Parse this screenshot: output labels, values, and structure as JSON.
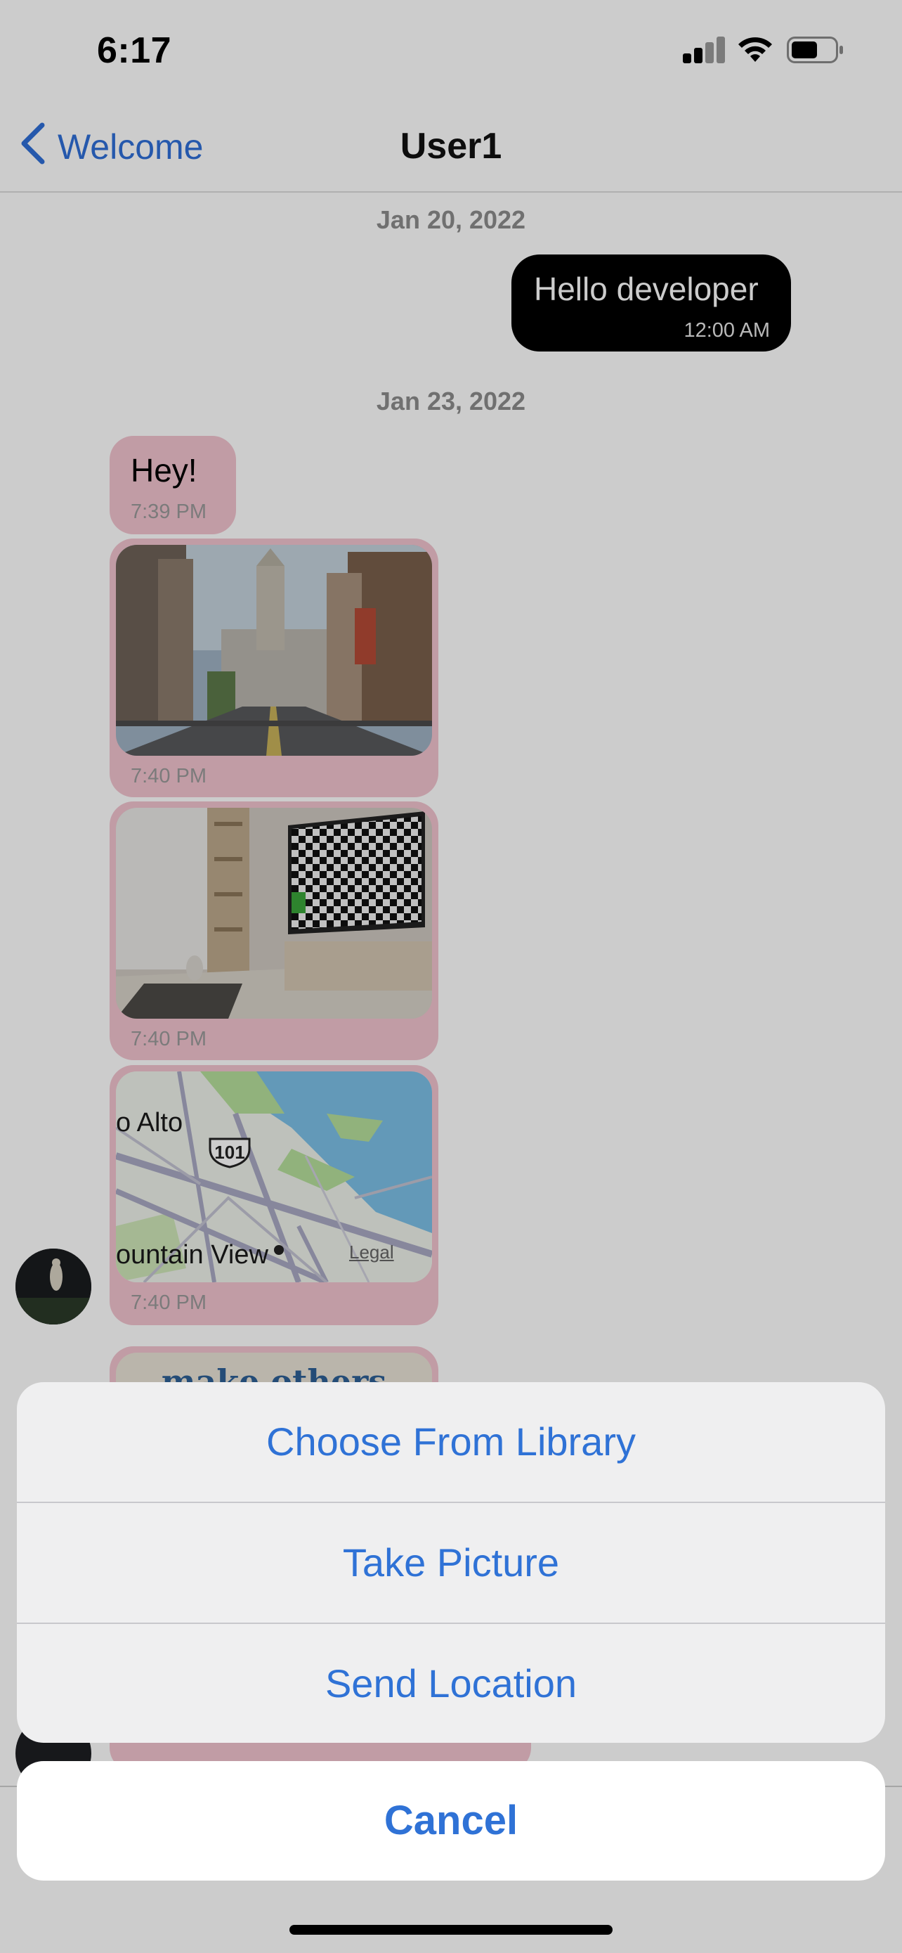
{
  "status_bar": {
    "time": "6:17",
    "signal_icon": "cellular-signal-icon",
    "wifi_icon": "wifi-icon",
    "battery_icon": "battery-icon"
  },
  "nav": {
    "back_label": "Welcome",
    "back_icon": "chevron-left-icon",
    "title": "User1"
  },
  "chat": {
    "dates": [
      "Jan 20, 2022",
      "Jan 23, 2022"
    ],
    "outgoing": [
      {
        "text": "Hello developer",
        "time": "12:00 AM"
      }
    ],
    "incoming": [
      {
        "kind": "text",
        "text": "Hey!",
        "time": "7:39 PM"
      },
      {
        "kind": "image",
        "description_icon": "city-street-photo",
        "time": "7:40 PM"
      },
      {
        "kind": "image",
        "description_icon": "living-room-photo",
        "time": "7:40 PM"
      },
      {
        "kind": "map",
        "time": "7:40 PM",
        "map_labels": {
          "city1": "o Alto",
          "highway": "101",
          "city2": "ountain View",
          "legal": "Legal"
        }
      },
      {
        "kind": "image",
        "partial_text": "make others"
      }
    ]
  },
  "action_sheet": {
    "options": [
      "Choose From Library",
      "Take Picture",
      "Send Location"
    ],
    "cancel": "Cancel"
  },
  "colors": {
    "accent": "#2f72d6",
    "incoming_bubble": "#f2c3cf",
    "outgoing_bubble": "#000000"
  }
}
